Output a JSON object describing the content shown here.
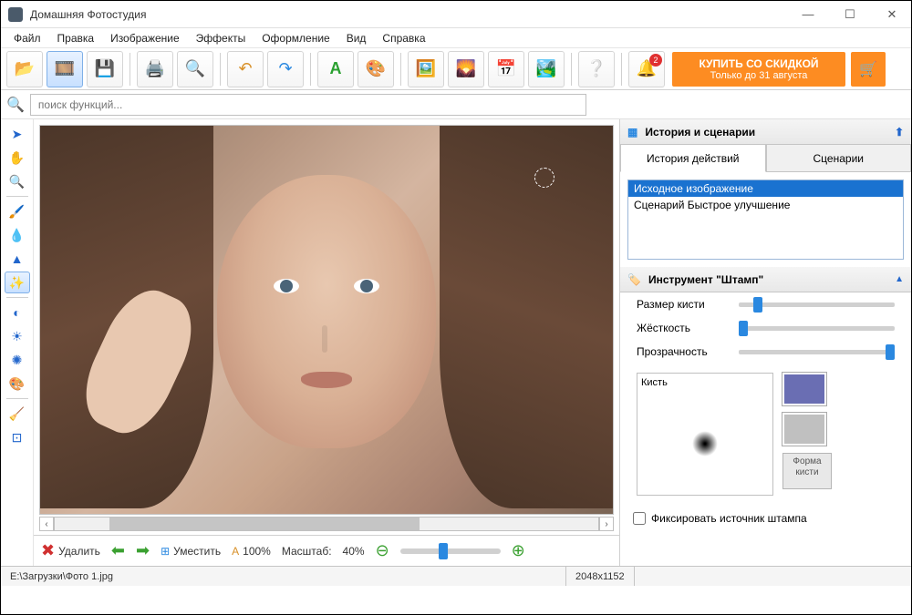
{
  "app": {
    "title": "Домашняя Фотостудия"
  },
  "menu": [
    "Файл",
    "Правка",
    "Изображение",
    "Эффекты",
    "Оформление",
    "Вид",
    "Справка"
  ],
  "search": {
    "placeholder": "поиск функций..."
  },
  "promo": {
    "line1": "КУПИТЬ СО СКИДКОЙ",
    "line2": "Только до 31 августа",
    "badge": "2"
  },
  "rightPanel": {
    "historyTitle": "История и сценарии",
    "tabs": [
      "История действий",
      "Сценарии"
    ],
    "historyItems": [
      "Исходное изображение",
      "Сценарий Быстрое улучшение"
    ],
    "toolTitle": "Инструмент \"Штамп\"",
    "props": {
      "size": "Размер кисти",
      "hardness": "Жёсткость",
      "opacity": "Прозрачность",
      "brush": "Кисть",
      "shapeBtn": "Форма кисти"
    },
    "fixSource": "Фиксировать источник штампа",
    "colors": {
      "primary": "#6a6eb3",
      "secondary": "#c0c0c0"
    }
  },
  "canvasFooter": {
    "delete": "Удалить",
    "fit": "Уместить",
    "zoom100": "100%",
    "scaleLabel": "Масштаб:",
    "scaleValue": "40%"
  },
  "status": {
    "path": "E:\\Загрузки\\Фото 1.jpg",
    "dims": "2048x1152"
  }
}
